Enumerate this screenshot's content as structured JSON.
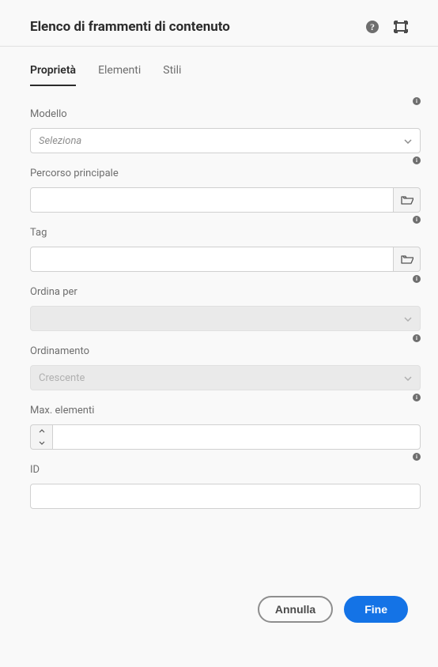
{
  "header": {
    "title": "Elenco di frammenti di contenuto"
  },
  "tabs": {
    "items": [
      {
        "label": "Proprietà",
        "active": true
      },
      {
        "label": "Elementi",
        "active": false
      },
      {
        "label": "Stili",
        "active": false
      }
    ]
  },
  "fields": {
    "model": {
      "label": "Modello",
      "placeholder": "Seleziona"
    },
    "parentPath": {
      "label": "Percorso principale",
      "value": ""
    },
    "tag": {
      "label": "Tag",
      "value": ""
    },
    "orderBy": {
      "label": "Ordina per",
      "value": ""
    },
    "sortOrder": {
      "label": "Ordinamento",
      "value": "Crescente"
    },
    "maxItems": {
      "label": "Max. elementi",
      "value": ""
    },
    "id": {
      "label": "ID",
      "value": ""
    }
  },
  "footer": {
    "cancel": "Annulla",
    "done": "Fine"
  }
}
